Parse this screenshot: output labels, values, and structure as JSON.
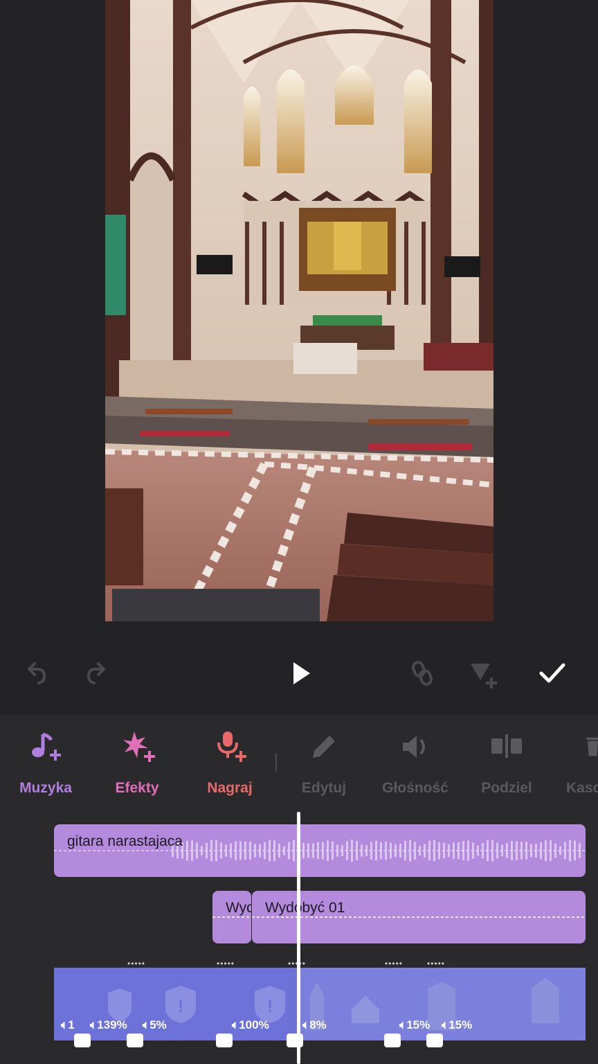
{
  "toolbar": {
    "tools": [
      {
        "label": "Muzyka",
        "icon": "music-add-icon",
        "color": "#b17fe0"
      },
      {
        "label": "Efekty",
        "icon": "sparkle-add-icon",
        "color": "#e06fb6"
      },
      {
        "label": "Nagraj",
        "icon": "mic-add-icon",
        "color": "#e86a6a"
      },
      {
        "label": "Edytuj",
        "icon": "pencil-icon",
        "color": "#5a5a5c"
      },
      {
        "label": "Głośność",
        "icon": "volume-icon",
        "color": "#5a5a5c"
      },
      {
        "label": "Podziel",
        "icon": "split-icon",
        "color": "#5a5a5c"
      },
      {
        "label": "Kaso",
        "icon": "trash-icon",
        "color": "#5a5a5c"
      }
    ]
  },
  "controls": {
    "undo": "undo-icon",
    "redo": "redo-icon",
    "play": "play-icon",
    "link": "link-icon",
    "keyframe": "keyframe-add-icon",
    "confirm": "check-icon"
  },
  "timeline": {
    "music_clip": {
      "title": "gitara narastajaca"
    },
    "sfx_clip_a": {
      "title": "Wyd"
    },
    "sfx_clip_b": {
      "title": "Wydobyć 01"
    },
    "volumes": [
      "1",
      "139%",
      "5%",
      "100%",
      "8%",
      "15%",
      "15%"
    ]
  },
  "colors": {
    "background": "#232325",
    "panel": "#2a2a2c",
    "audio_clip": "#b48add",
    "video_track": "#6d72d8"
  }
}
